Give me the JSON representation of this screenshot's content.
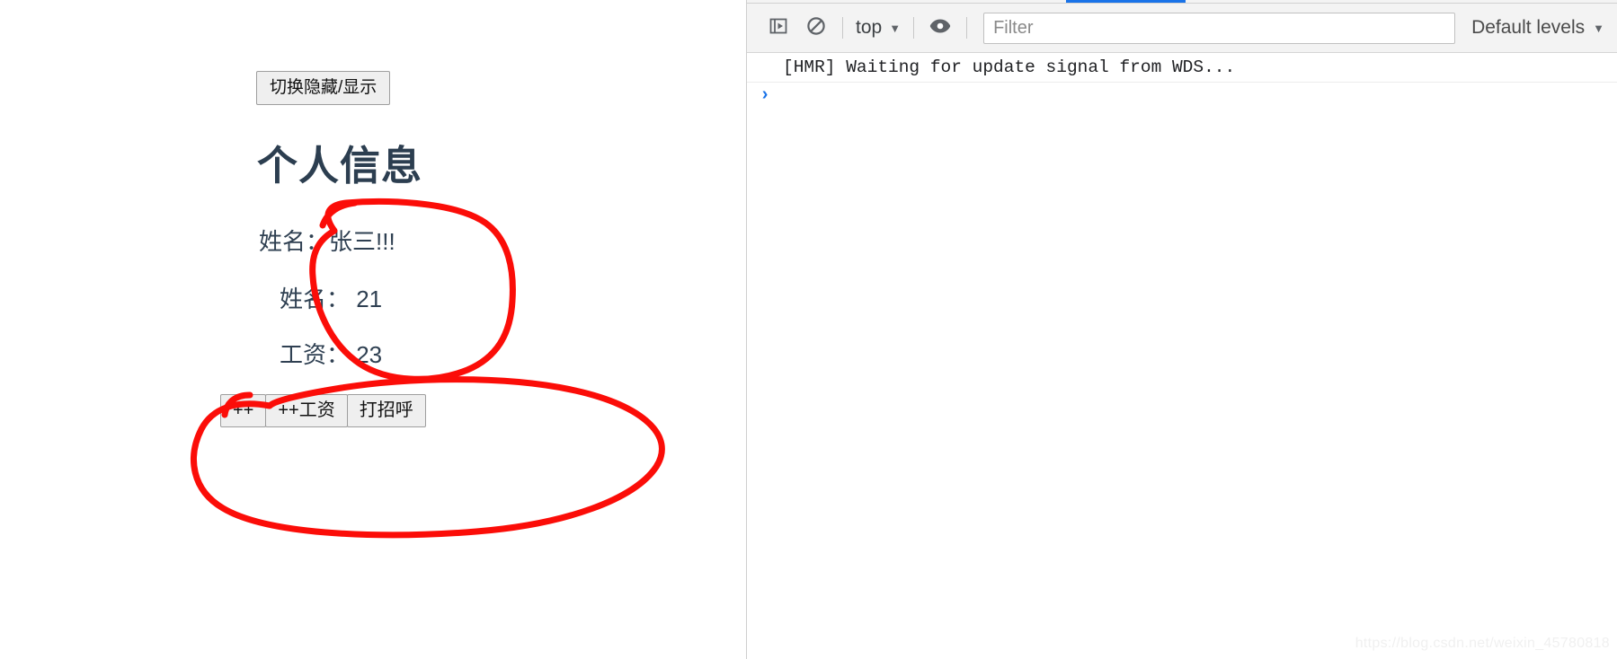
{
  "page": {
    "toggle_button_label": "切换隐藏/显示",
    "title": "个人信息",
    "info_lines": [
      "姓名：张三!!!",
      "姓名： 21",
      "工资： 23"
    ],
    "action_buttons": [
      "++",
      "++工资",
      "打招呼"
    ],
    "title_color": "#2c3e50",
    "text_color": "#2f4052",
    "annotation_color": "#fb0d08"
  },
  "devtools": {
    "toolbar": {
      "sidebar_toggle_icon": "show-console-sidebar-icon",
      "clear_console_icon": "clear-console-icon",
      "context_value": "top",
      "context_caret": "▼",
      "eye_icon": "live-expression-eye-icon",
      "filter_placeholder": "Filter",
      "filter_value": "",
      "levels_value": "Default levels",
      "levels_caret": "▼",
      "tab_indicator_color": "#1a73e8"
    },
    "console": {
      "messages": [
        "[HMR] Waiting for update signal from WDS..."
      ],
      "prompt_caret": "›"
    }
  },
  "watermark": "https://blog.csdn.net/weixin_45780818"
}
